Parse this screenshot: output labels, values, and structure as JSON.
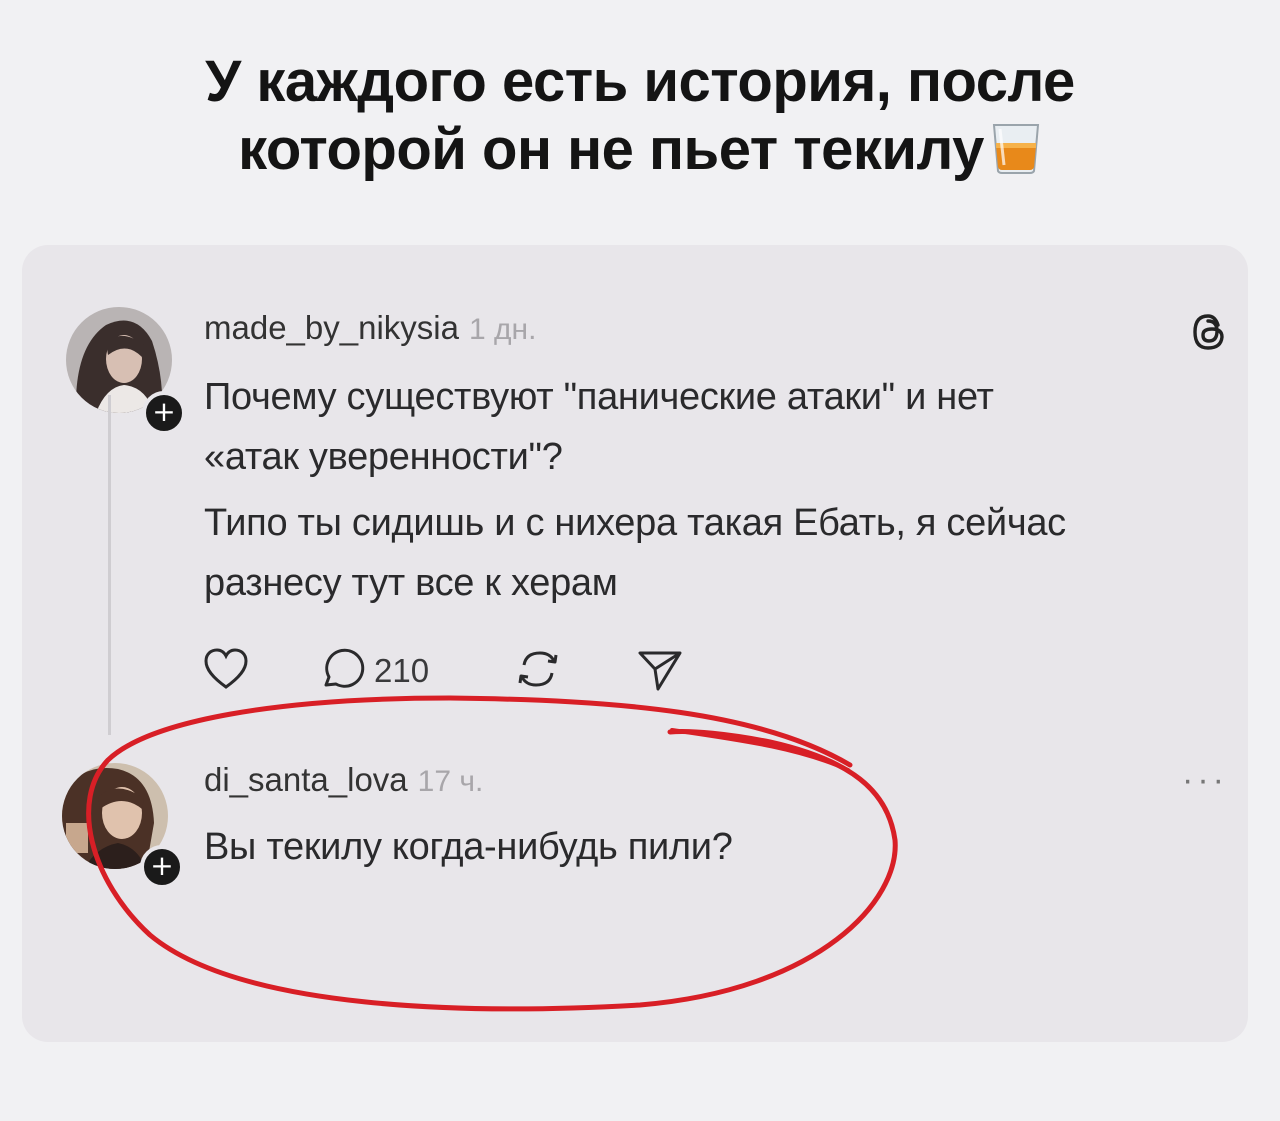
{
  "caption": {
    "line1": "У каждого есть история, после",
    "line2": "которой он не пьет текилу"
  },
  "post": {
    "username": "made_by_nikysia",
    "time": "1 дн.",
    "paragraph1_line1": "Почему существуют \"панические атаки\" и нет",
    "paragraph1_line2": "«атак уверенности\"?",
    "paragraph2_line1": "Типо ты сидишь и с нихера такая Ебать, я сейчас",
    "paragraph2_line2": "разнесу тут все к херам",
    "comment_count": "210",
    "plus_label": "+"
  },
  "reply": {
    "username": "di_santa_lova",
    "time": "17 ч.",
    "text": "Вы текилу когда-нибудь пили?",
    "more_label": "···",
    "plus_label": "+"
  },
  "colors": {
    "annotation": "#d81f26",
    "card": "#e8e6ea",
    "background": "#f1f1f3"
  },
  "icons": [
    "tumbler-glass-icon",
    "threads-logo-icon",
    "heart-icon",
    "comment-icon",
    "repost-icon",
    "share-icon",
    "more-icon"
  ]
}
